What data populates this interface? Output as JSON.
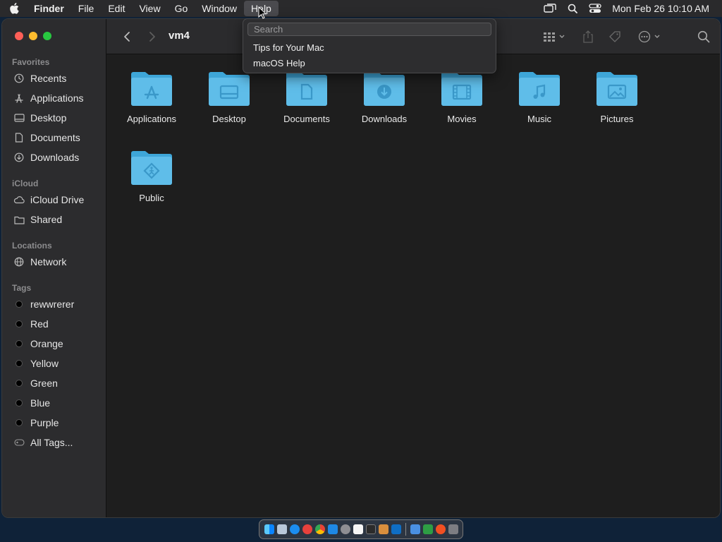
{
  "menubar": {
    "app_name": "Finder",
    "items": [
      "File",
      "Edit",
      "View",
      "Go",
      "Window",
      "Help"
    ],
    "clock": "Mon Feb 26  10:10 AM",
    "icons": [
      "apple-icon",
      "screen-mirroring-icon",
      "spotlight-search-icon",
      "control-center-icon"
    ]
  },
  "help_menu": {
    "search_placeholder": "Search",
    "items": [
      "Tips for Your Mac",
      "macOS Help"
    ]
  },
  "window": {
    "title": "vm4"
  },
  "sidebar": {
    "favorites_header": "Favorites",
    "favorites": [
      "Recents",
      "Applications",
      "Desktop",
      "Documents",
      "Downloads"
    ],
    "icloud_header": "iCloud",
    "icloud": [
      "iCloud Drive",
      "Shared"
    ],
    "locations_header": "Locations",
    "locations": [
      "Network"
    ],
    "tags_header": "Tags",
    "tags": [
      "rewwrerer",
      "Red",
      "Orange",
      "Yellow",
      "Green",
      "Blue",
      "Purple"
    ],
    "all_tags": "All Tags..."
  },
  "files": [
    "Applications",
    "Desktop",
    "Documents",
    "Downloads",
    "Movies",
    "Music",
    "Pictures",
    "Public"
  ],
  "colors": {
    "folder": "#5fbde9",
    "folder_dark": "#3ea6d8",
    "accent": "#0a84ff"
  }
}
